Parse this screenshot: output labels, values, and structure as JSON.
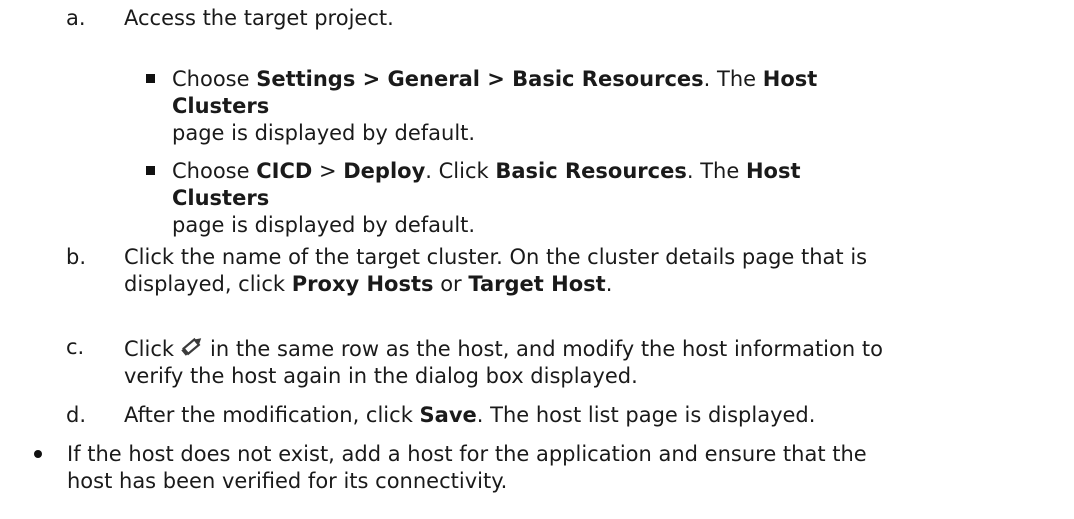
{
  "steps": {
    "a": {
      "marker": "a.",
      "text": "Access the target project.",
      "sub": [
        {
          "pre": "Choose ",
          "b1": "Settings > General > Basic Resources",
          "mid": ". The ",
          "b2": "Host Clusters",
          "post": "page is displayed by default."
        },
        {
          "pre": "Choose ",
          "b1": "CICD",
          "mid1": " > ",
          "b2": "Deploy",
          "mid2": ". Click ",
          "b3": "Basic Resources",
          "mid3": ". The ",
          "b4": "Host Clusters",
          "post": "page is displayed by default."
        }
      ]
    },
    "b": {
      "marker": "b.",
      "line1": "Click the name of the target cluster. On the cluster details page that is",
      "pre": "displayed, click ",
      "b1": "Proxy Hosts",
      "mid": " or ",
      "b2": "Target Host",
      "post": "."
    },
    "c": {
      "marker": "c.",
      "pre": "Click",
      "icon": "edit-pencil-icon",
      "post": "in the same row as the host, and modify the host information to",
      "line2": "verify the host again in the dialog box displayed."
    },
    "d": {
      "marker": "d.",
      "pre": "After the modification, click ",
      "b1": "Save",
      "post": ". The host list page is displayed."
    }
  },
  "bullet": {
    "line1": "If the host does not exist, add a host for the application and ensure that the",
    "line2": "host has been verified for its connectivity."
  }
}
